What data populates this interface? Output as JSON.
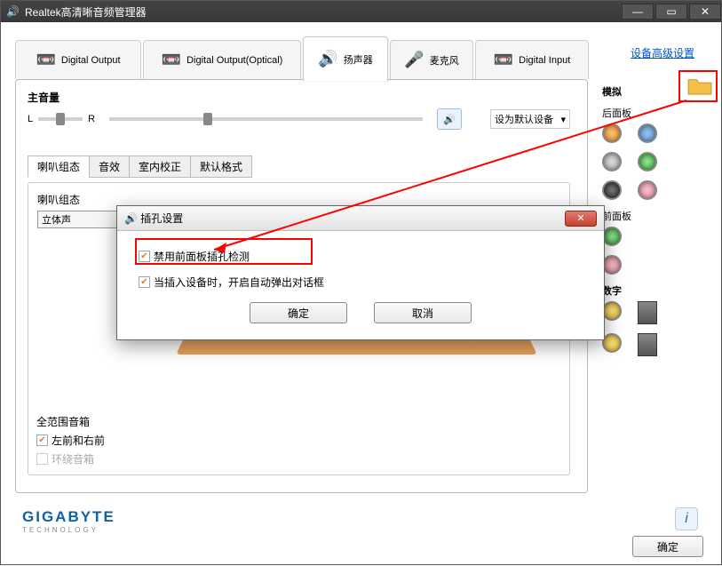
{
  "window": {
    "title": "Realtek高清晰音频管理器"
  },
  "tabs": [
    {
      "label": "Digital Output"
    },
    {
      "label": "Digital Output(Optical)"
    },
    {
      "label": "扬声器"
    },
    {
      "label": "麦克风"
    },
    {
      "label": "Digital Input"
    }
  ],
  "adv_link": "设备高级设置",
  "volume": {
    "title": "主音量",
    "left": "L",
    "right": "R",
    "set_default": "设为默认设备"
  },
  "sub_tabs": [
    "喇叭组态",
    "音效",
    "室内校正",
    "默认格式"
  ],
  "speaker_cfg": {
    "group_title": "喇叭组态",
    "dropdown_value": "立体声",
    "full_range_title": "全范围音箱",
    "opt_front": "左前和右前",
    "opt_surround": "环绕音箱"
  },
  "right": {
    "analog": "模拟",
    "rear_panel": "后面板",
    "front_panel": "前面板",
    "digital": "数字"
  },
  "modal": {
    "title": "插孔设置",
    "opt_disable_detect": "禁用前面板插孔检测",
    "opt_auto_popup": "当插入设备时，开启自动弹出对话框",
    "ok": "确定",
    "cancel": "取消"
  },
  "footer": {
    "brand_top": "GIGABYTE",
    "brand_sub": "TECHNOLOGY",
    "ok": "确定"
  }
}
